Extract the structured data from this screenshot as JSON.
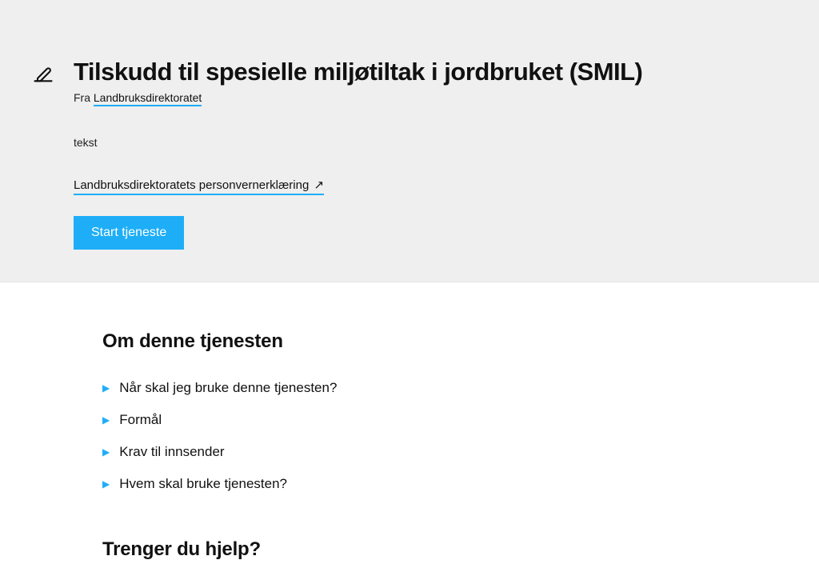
{
  "hero": {
    "title": "Tilskudd til spesielle miljøtiltak i jordbruket (SMIL)",
    "from_prefix": "Fra ",
    "from_link": "Landbruksdirektoratet",
    "tekst": "tekst",
    "privacy_link": "Landbruksdirektoratets personvernerklæring",
    "start_button": "Start tjeneste"
  },
  "about": {
    "heading": "Om denne tjenesten",
    "items": [
      "Når skal jeg bruke denne tjenesten?",
      "Formål",
      "Krav til innsender",
      "Hvem skal bruke tjenesten?"
    ]
  },
  "help": {
    "heading": "Trenger du hjelp?"
  }
}
